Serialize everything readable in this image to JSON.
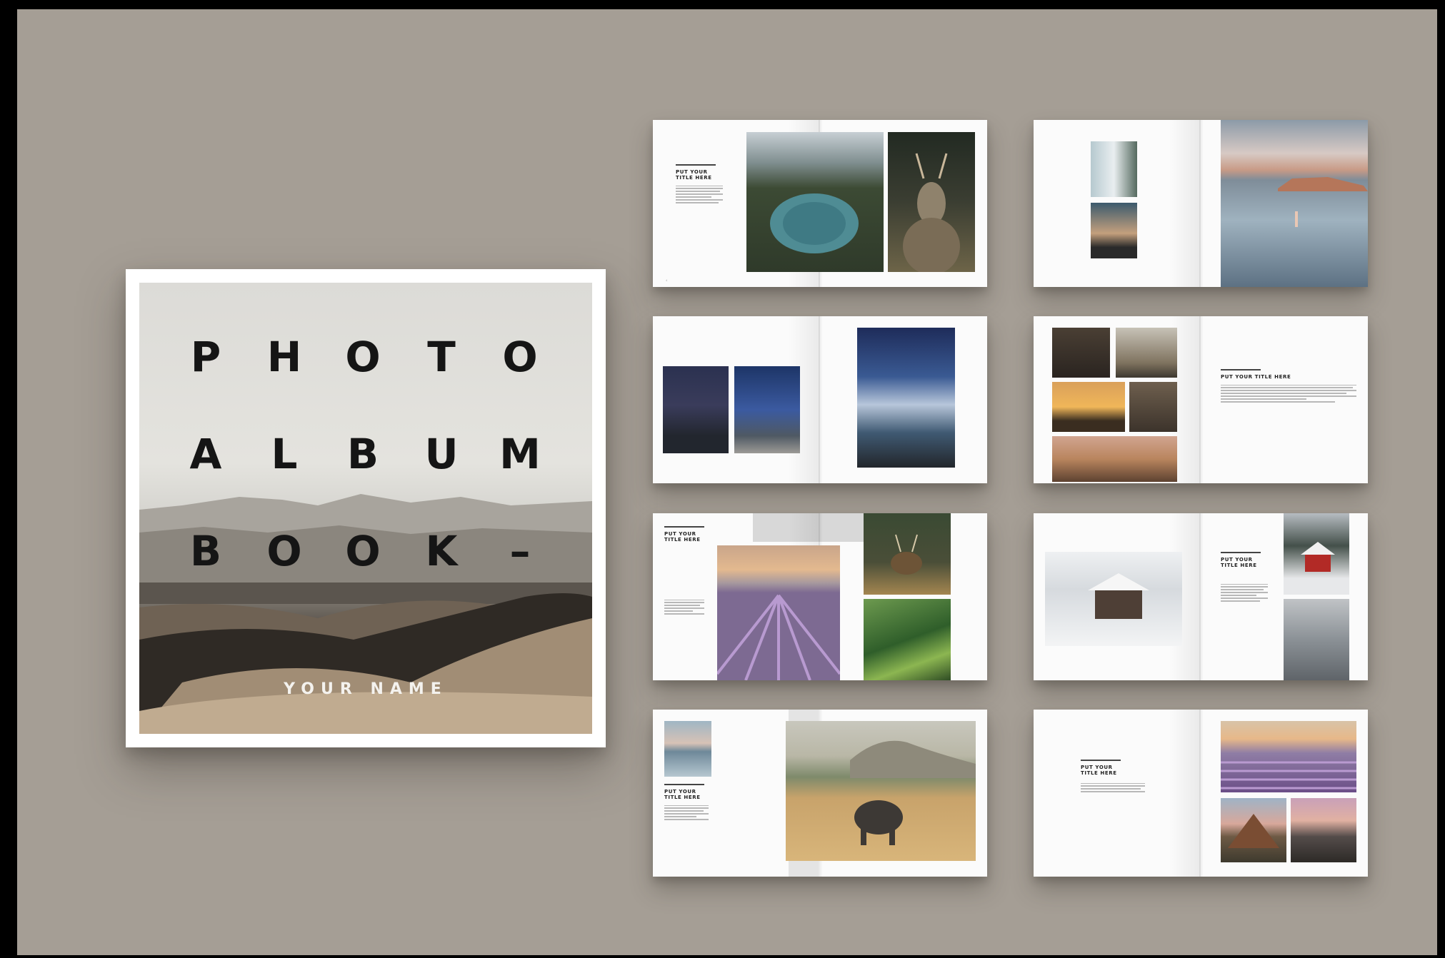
{
  "cover": {
    "title_words": [
      "PHOTO",
      "ALBUM",
      "BOOK –"
    ],
    "author": "YOUR NAME"
  },
  "spreads": [
    {
      "title": "PUT YOUR\nTITLE HERE"
    },
    {
      "title": ""
    },
    {
      "title": ""
    },
    {
      "title": "PUT YOUR TITLE HERE"
    },
    {
      "title": "PUT YOUR\nTITLE HERE"
    },
    {
      "title": "PUT YOUR\nTITLE HERE"
    },
    {
      "title": "PUT YOUR\nTITLE HERE"
    },
    {
      "title": "PUT YOUR\nTITLE HERE"
    }
  ],
  "colors": {
    "background": "#a59e95",
    "frame": "#000000",
    "page": "#fbfbfb",
    "lavender": "#8d6aa6",
    "lake": "#4f8c94"
  }
}
